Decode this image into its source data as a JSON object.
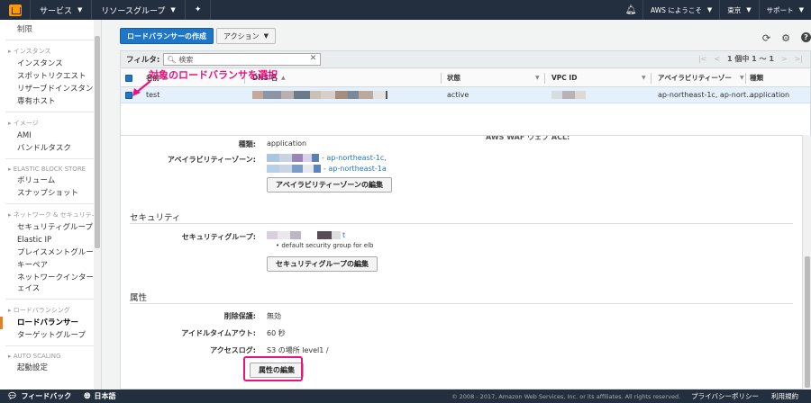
{
  "topnav": {
    "services": "サービス",
    "resource_groups": "リソースグループ",
    "welcome": "AWS にようこそ",
    "region": "東京",
    "support": "サポート"
  },
  "sidebar": {
    "top_item": "制限",
    "sections": [
      {
        "title": "インスタンス",
        "items": [
          "インスタンス",
          "スポットリクエスト",
          "リザーブドインスタンス",
          "専有ホスト"
        ]
      },
      {
        "title": "イメージ",
        "items": [
          "AMI",
          "バンドルタスク"
        ]
      },
      {
        "title": "ELASTIC BLOCK STORE",
        "items": [
          "ボリューム",
          "スナップショット"
        ]
      },
      {
        "title": "ネットワーク & セキュリティ",
        "items": [
          "セキュリティグループ",
          "Elastic IP",
          "プレイスメントグループ",
          "キーペア",
          "ネットワークインターフェイス"
        ]
      },
      {
        "title": "ロードバランシング",
        "items": [
          "ロードバランサー",
          "ターゲットグループ"
        ]
      },
      {
        "title": "AUTO SCALING",
        "items": [
          "起動設定"
        ]
      }
    ],
    "active_item": "ロードバランサー"
  },
  "toolbar": {
    "create_label": "ロードバランサーの作成",
    "action_label": "アクション"
  },
  "filter": {
    "label": "フィルタ:",
    "placeholder": "検索",
    "pager_text": "1 個中 1 ～ 1"
  },
  "annotation": "対象のロードバランサを選択",
  "table": {
    "headers": [
      "名前",
      "DNS 名",
      "状態",
      "VPC ID",
      "アベイラビリティーゾー",
      "種類"
    ],
    "row": {
      "name": "test",
      "state": "active",
      "az": "ap-northeast-1c, ap-nort...",
      "type": "application"
    }
  },
  "detail": {
    "cutoff_text": "AWS WAF ウェブ ACL:",
    "type_label": "種類:",
    "type_value": "application",
    "az_label": "アベイラビリティーゾーン:",
    "az_values": [
      "- ap-northeast-1c,",
      "- ap-northeast-1a"
    ],
    "az_button": "アベイラビリティーゾーンの編集",
    "security_title": "セキュリティ",
    "sg_label": "セキュリティグループ:",
    "sg_suffix": "t",
    "sg_desc": "• default security group for elb",
    "sg_button": "セキュリティグループの編集",
    "attributes_title": "属性",
    "deletion_label": "削除保護:",
    "deletion_value": "無効",
    "idle_label": "アイドルタイムアウト:",
    "idle_value": "60 秒",
    "access_log_label": "アクセスログ:",
    "access_log_value": "S3 の場所 level1 /",
    "attr_button": "属性の編集"
  },
  "footer": {
    "feedback": "フィードバック",
    "language": "日本語",
    "copyright": "© 2008 - 2017, Amazon Web Services, Inc. or its affiliates. All rights reserved.",
    "privacy": "プライバシーポリシー",
    "terms": "利用規約"
  },
  "colors": {
    "nav_bg": "#232f3e",
    "primary": "#1e76c8",
    "annotation": "#e8137e",
    "selected_row": "#e4f0fb"
  }
}
